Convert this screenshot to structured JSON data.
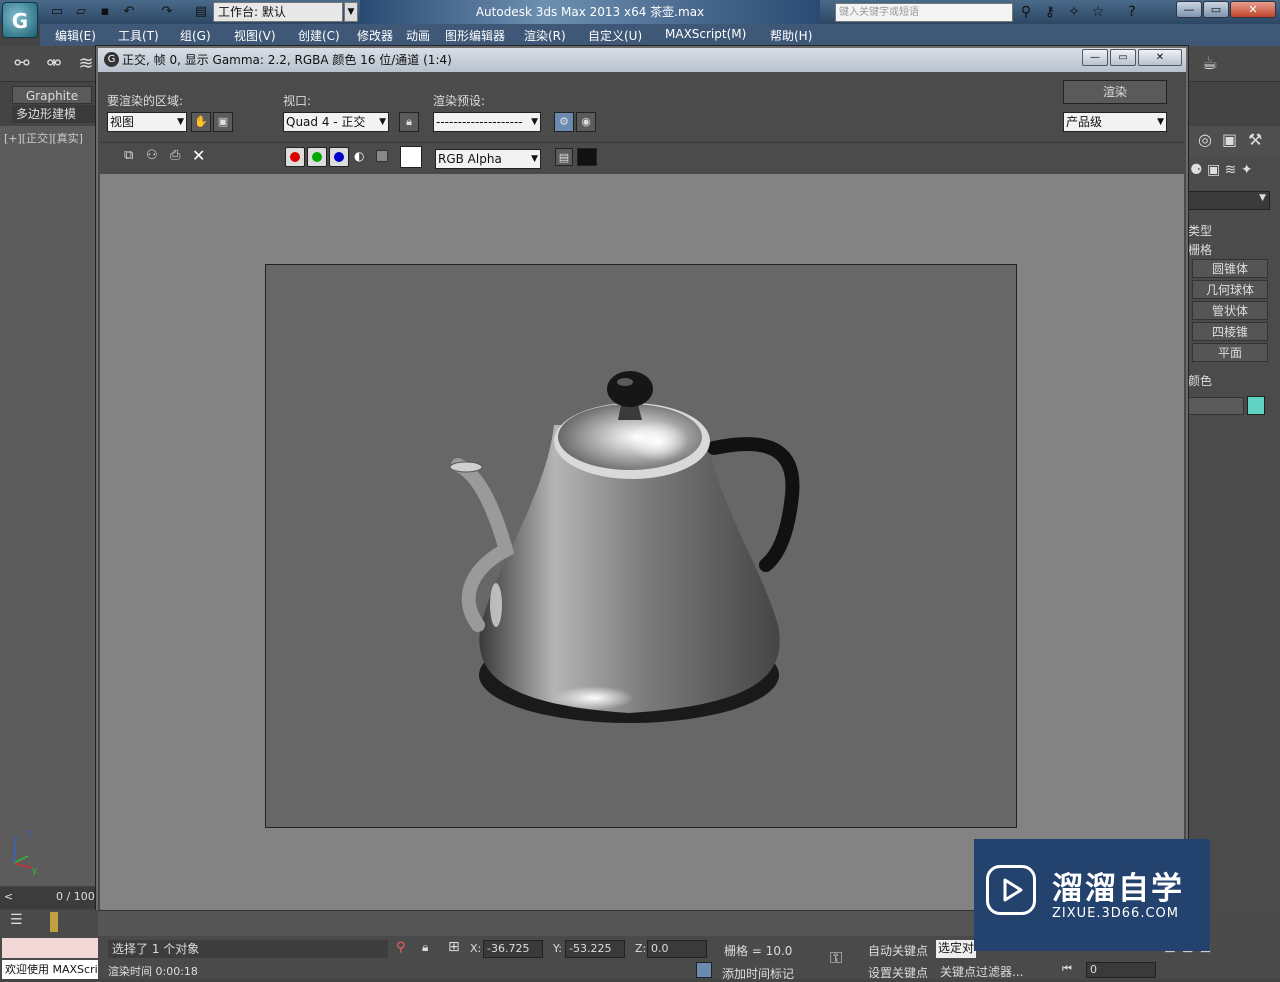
{
  "app": {
    "title": "Autodesk 3ds Max  2013 x64      茶壶.max",
    "workspace_label": "工作台: 默认",
    "search_placeholder": "键入关键字或短语"
  },
  "menus": [
    "编辑(E)",
    "工具(T)",
    "组(G)",
    "视图(V)",
    "创建(C)",
    "修改器",
    "动画",
    "图形编辑器",
    "渲染(R)",
    "自定义(U)",
    "MAXScript(M)",
    "帮助(H)"
  ],
  "ribbon": {
    "graphite_tab": "Graphite",
    "poly_tab": "多边形建模"
  },
  "viewport": {
    "label": "[+][正交][真实]"
  },
  "render_frame": {
    "title": "正交, 帧 0, 显示 Gamma: 2.2, RGBA 颜色 16 位/通道 (1:4)",
    "area_label": "要渲染的区域:",
    "area_value": "视图",
    "viewport_label": "视口:",
    "viewport_value": "Quad 4 - 正交",
    "preset_label": "渲染预设:",
    "preset_value": "--------------------",
    "render_button": "渲染",
    "quality_value": "产品级",
    "channel_value": "RGB Alpha"
  },
  "command_panel": {
    "type_label": "类型",
    "grid_label": "栅格",
    "buttons": [
      "圆锥体",
      "几何球体",
      "管状体",
      "四棱锥",
      "平面"
    ],
    "color_label": "颜色",
    "swatch_color": "#5fd2c2"
  },
  "status": {
    "selection": "选择了 1 个对象",
    "render_time": "渲染时间  0:00:18",
    "welcome": "欢迎使用 MAXScri",
    "time_slider": "0 / 100",
    "x_label": "X:",
    "x_value": "-36.725",
    "y_label": "Y:",
    "y_value": "-53.225",
    "z_label": "Z:",
    "z_value": "0.0",
    "grid": "栅格 = 10.0",
    "auto_key": "自动关键点",
    "set_key": "设置关键点",
    "selection_set": "选定对",
    "key_filter": "关键点过滤器...",
    "add_time_tag": "添加时间标记",
    "frame_value": "0"
  },
  "watermark": {
    "title": "溜溜自学",
    "url": "ZIXUE.3D66.COM"
  }
}
